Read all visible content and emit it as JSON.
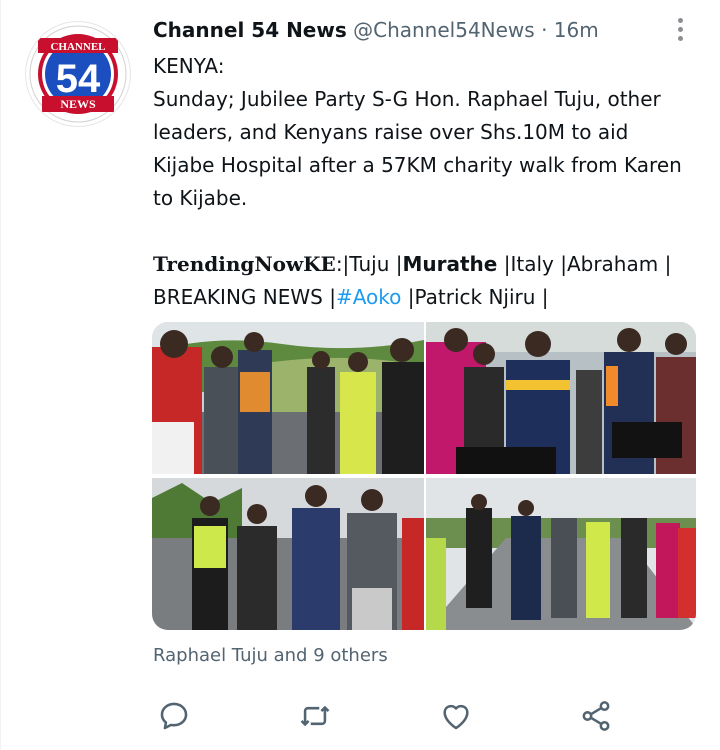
{
  "tweet": {
    "display_name": "Channel 54 News",
    "handle": "@Channel54News",
    "separator": "·",
    "time": "16m",
    "avatar": {
      "top_text": "CHANNEL",
      "number": "54",
      "bottom_text": "NEWS"
    },
    "text": {
      "line1": "KENYA:",
      "line2": "Sunday; Jubilee Party S-G Hon. Raphael Tuju, other leaders, and Kenyans raise over Shs.10M to aid Kijabe Hospital after a 57KM charity walk from Karen to Kijabe.",
      "trending_label": "TrendingNowKE",
      "trending_colon": ":|Tuju |",
      "murathe": "Murathe",
      "after_murathe": " |Italy |Abraham |",
      "breaking": "BREAKING NEWS |",
      "hashtag": "#Aoko",
      "after_hashtag": " |Patrick Njiru |"
    },
    "liked_by": "Raphael Tuju and 9 others",
    "icons": {
      "more": "more-vertical-icon",
      "reply": "reply-icon",
      "retweet": "retweet-icon",
      "like": "heart-icon",
      "share": "share-icon"
    }
  }
}
